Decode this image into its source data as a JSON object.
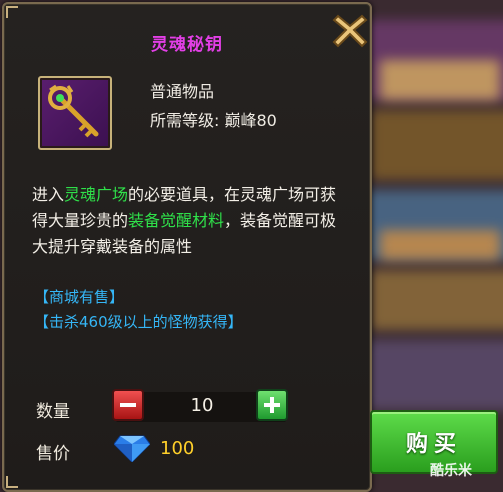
{
  "dialog": {
    "title": "灵魂秘钥",
    "item": {
      "icon": "golden-key-icon",
      "type": "普通物品",
      "level_req": "所需等级: 巅峰80"
    },
    "description": {
      "p1": "进入",
      "hl1": "灵魂广场",
      "p2": "的必要道具，在灵魂广场可获得大量珍贵的",
      "hl2": "装备觉醒材料",
      "p3": "，装备觉醒可极大提升穿戴装备的属性"
    },
    "sources": [
      "【商城有售】",
      "【击杀460级以上的怪物获得】"
    ],
    "quantity": {
      "label": "数量",
      "value": "10"
    },
    "price": {
      "label": "售价",
      "value": "100",
      "currency_icon": "diamond-icon"
    },
    "buy_label": "购买",
    "colors": {
      "title": "#e23fe6",
      "highlight": "#2fe04a",
      "source": "#35b6f6",
      "price": "#ffcf2a",
      "buy": "#3fbf2e"
    }
  },
  "watermark": "酷乐米"
}
